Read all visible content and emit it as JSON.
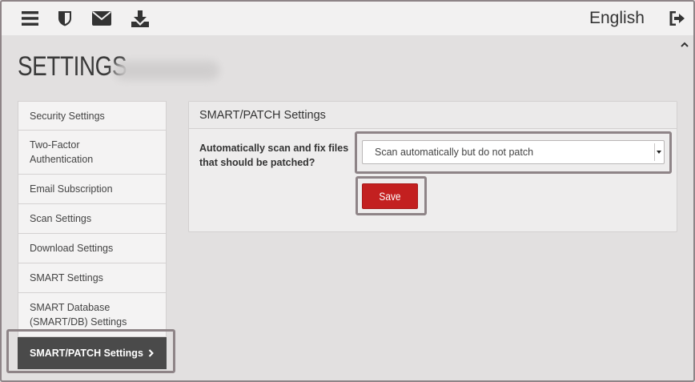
{
  "topbar": {
    "icons": [
      "menu-icon",
      "shield-icon",
      "envelope-icon",
      "download-icon",
      "sign-out-icon"
    ],
    "language": "English"
  },
  "page": {
    "title": "SETTINGS"
  },
  "sidebar": {
    "items": [
      {
        "label": "Security Settings"
      },
      {
        "label": "Two-Factor Authentication"
      },
      {
        "label": "Email Subscription"
      },
      {
        "label": "Scan Settings"
      },
      {
        "label": "Download Settings"
      },
      {
        "label": "SMART Settings"
      },
      {
        "label": "SMART Database (SMART/DB) Settings"
      },
      {
        "label": "SMART/PATCH Settings",
        "active": true
      }
    ]
  },
  "panel": {
    "title": "SMART/PATCH Settings",
    "question": "Automatically scan and fix files that should be patched?",
    "select_value": "Scan automatically but do not patch",
    "save_label": "Save"
  },
  "colors": {
    "accent_red": "#c32020",
    "active_dark": "#4a4a4a",
    "highlight_border": "#8e8487"
  }
}
